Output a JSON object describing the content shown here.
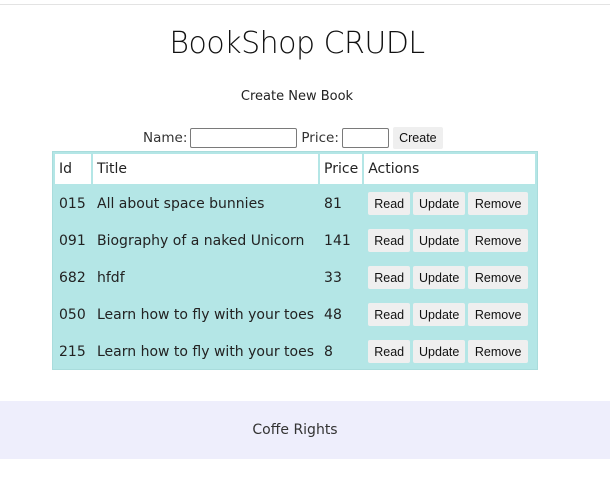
{
  "header": {
    "title": "BookShop CRUDL",
    "subtitle": "Create New Book"
  },
  "form": {
    "name_label": "Name:",
    "name_value": "",
    "price_label": "Price:",
    "price_value": "",
    "create_label": "Create"
  },
  "table": {
    "columns": [
      "Id",
      "Title",
      "Price",
      "Actions"
    ],
    "rows": [
      {
        "id": "015",
        "title": "All about space bunnies",
        "price": "81"
      },
      {
        "id": "091",
        "title": "Biography of a naked Unicorn",
        "price": "141"
      },
      {
        "id": "682",
        "title": "hfdf",
        "price": "33"
      },
      {
        "id": "050",
        "title": "Learn how to fly with your toes",
        "price": "48"
      },
      {
        "id": "215",
        "title": "Learn how to fly with your toes",
        "price": "8"
      }
    ],
    "actions": {
      "read": "Read",
      "update": "Update",
      "remove": "Remove"
    }
  },
  "footer": {
    "text": "Coffe Rights"
  },
  "colors": {
    "table_bg": "#b4e6e6",
    "footer_bg": "#eeeefc",
    "button_bg": "#efefef"
  }
}
